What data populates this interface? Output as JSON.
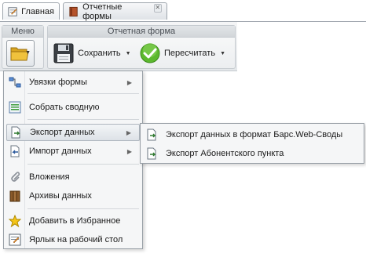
{
  "tabs": [
    {
      "label": "Главная",
      "icon": "home-form-icon"
    },
    {
      "label": "Отчетные формы",
      "icon": "book-icon",
      "closable": true
    }
  ],
  "ribbon": {
    "menu_group_title": "Меню",
    "report_group_title": "Отчетная форма",
    "save_label": "Сохранить",
    "recalc_label": "Пересчитать"
  },
  "menu": {
    "items": [
      {
        "label": "Увязки формы",
        "icon": "links-icon",
        "submenu": true
      },
      {
        "label": "Собрать сводную",
        "icon": "collect-icon",
        "submenu": false
      },
      {
        "label": "Экспорт данных",
        "icon": "export-icon",
        "submenu": true,
        "highlighted": true
      },
      {
        "label": "Импорт данных",
        "icon": "import-icon",
        "submenu": true
      },
      {
        "label": "Вложения",
        "icon": "paperclip-icon",
        "submenu": false
      },
      {
        "label": "Архивы данных",
        "icon": "archive-icon",
        "submenu": false
      },
      {
        "label": "Добавить в Избранное",
        "icon": "star-icon",
        "submenu": false
      },
      {
        "label": "Ярлык на рабочий стол",
        "icon": "shortcut-icon",
        "submenu": false
      }
    ]
  },
  "submenu": {
    "items": [
      {
        "label": "Экспорт данных в формат Барс.Web-Своды",
        "icon": "export-file-icon"
      },
      {
        "label": "Экспорт Абонентского пункта",
        "icon": "export-file-icon"
      }
    ]
  },
  "colors": {
    "accent_green": "#5cb82e",
    "folder_yellow": "#f0c23c",
    "border": "#99a0a7"
  }
}
